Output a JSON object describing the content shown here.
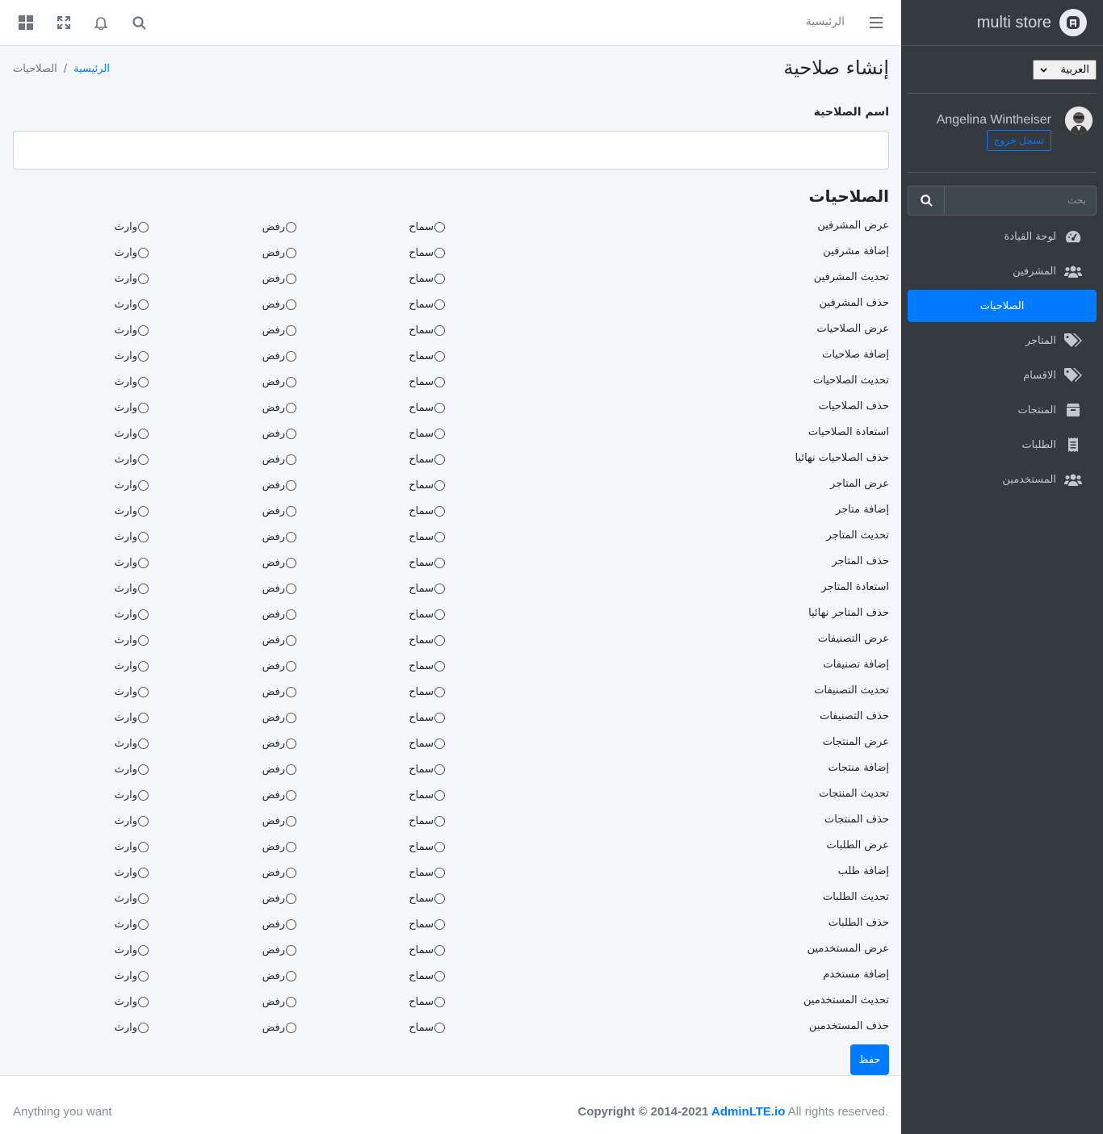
{
  "brand": {
    "name": "multi store",
    "logo_icon": "adminlte-logo-icon"
  },
  "language": {
    "selected": "العربية"
  },
  "user": {
    "name": "Angelina Wintheiser",
    "logout_label": "تسجل خروج"
  },
  "sidebar_search": {
    "placeholder": "بحث"
  },
  "sidebar": {
    "items": [
      {
        "label": "لوحة القيادة",
        "icon": "tachometer-icon"
      },
      {
        "label": "المشرفين",
        "icon": "users-icon"
      },
      {
        "label": "الصلاحيات",
        "icon": "",
        "active": true
      },
      {
        "label": "المتاجر",
        "icon": "tags-icon"
      },
      {
        "label": "الاقسام",
        "icon": "tags-icon"
      },
      {
        "label": "المنتجات",
        "icon": "box-icon"
      },
      {
        "label": "الطلبات",
        "icon": "receipt-icon"
      },
      {
        "label": "المستخدمين",
        "icon": "users-icon"
      }
    ]
  },
  "topbar": {
    "home_link": "الرئيسية"
  },
  "page": {
    "title": "إنشاء صلاحية"
  },
  "breadcrumb": {
    "home": "الرئيسية",
    "separator": "/",
    "current": "الصلاحيات"
  },
  "form": {
    "name_label": "اسم الصلاحية",
    "name_value": "",
    "permissions_title": "الصلاحيات",
    "options": {
      "allow": "سماح",
      "deny": "رفض",
      "inherit": "وارث"
    },
    "permissions": [
      "عرض المشرفين",
      "إضافة مشرفين",
      "تحديث المشرفين",
      "حذف المشرفين",
      "عرض الصلاحيات",
      "إضافة صلاحيات",
      "تحديث الصلاحيات",
      "حذف الصلاحيات",
      "استعادة الصلاحيات",
      "حذف الصلاحيات نهائيا",
      "عرض المتاجر",
      "إضافة متاجر",
      "تحديث المتاجر",
      "حذف المتاجر",
      "استعادة المتاجر",
      "حذف المتاجر نهائيا",
      "عرض التصنيفات",
      "إضافة تصنيفات",
      "تحديث التصنيفات",
      "حذف التصنيفات",
      "عرض المنتجات",
      "إضافة منتجات",
      "تحديث المنتجات",
      "حذف المنتجات",
      "عرض الطلبات",
      "إضافة طلب",
      "تحديث الطلبات",
      "حذف الطلبات",
      "عرض المستخدمين",
      "إضافة مستخدم",
      "تحديث المستخدمين",
      "حذف المستخدمين"
    ],
    "save_label": "حفظ"
  },
  "footer": {
    "left": "Anything you want",
    "copyright_prefix": "Copyright © 2014-2021 ",
    "copyright_link": "AdminLTE.io",
    "copyright_suffix": " All rights reserved."
  },
  "colors": {
    "primary": "#007bff",
    "sidebar_bg": "#343a40",
    "content_bg": "#f4f6f9"
  }
}
